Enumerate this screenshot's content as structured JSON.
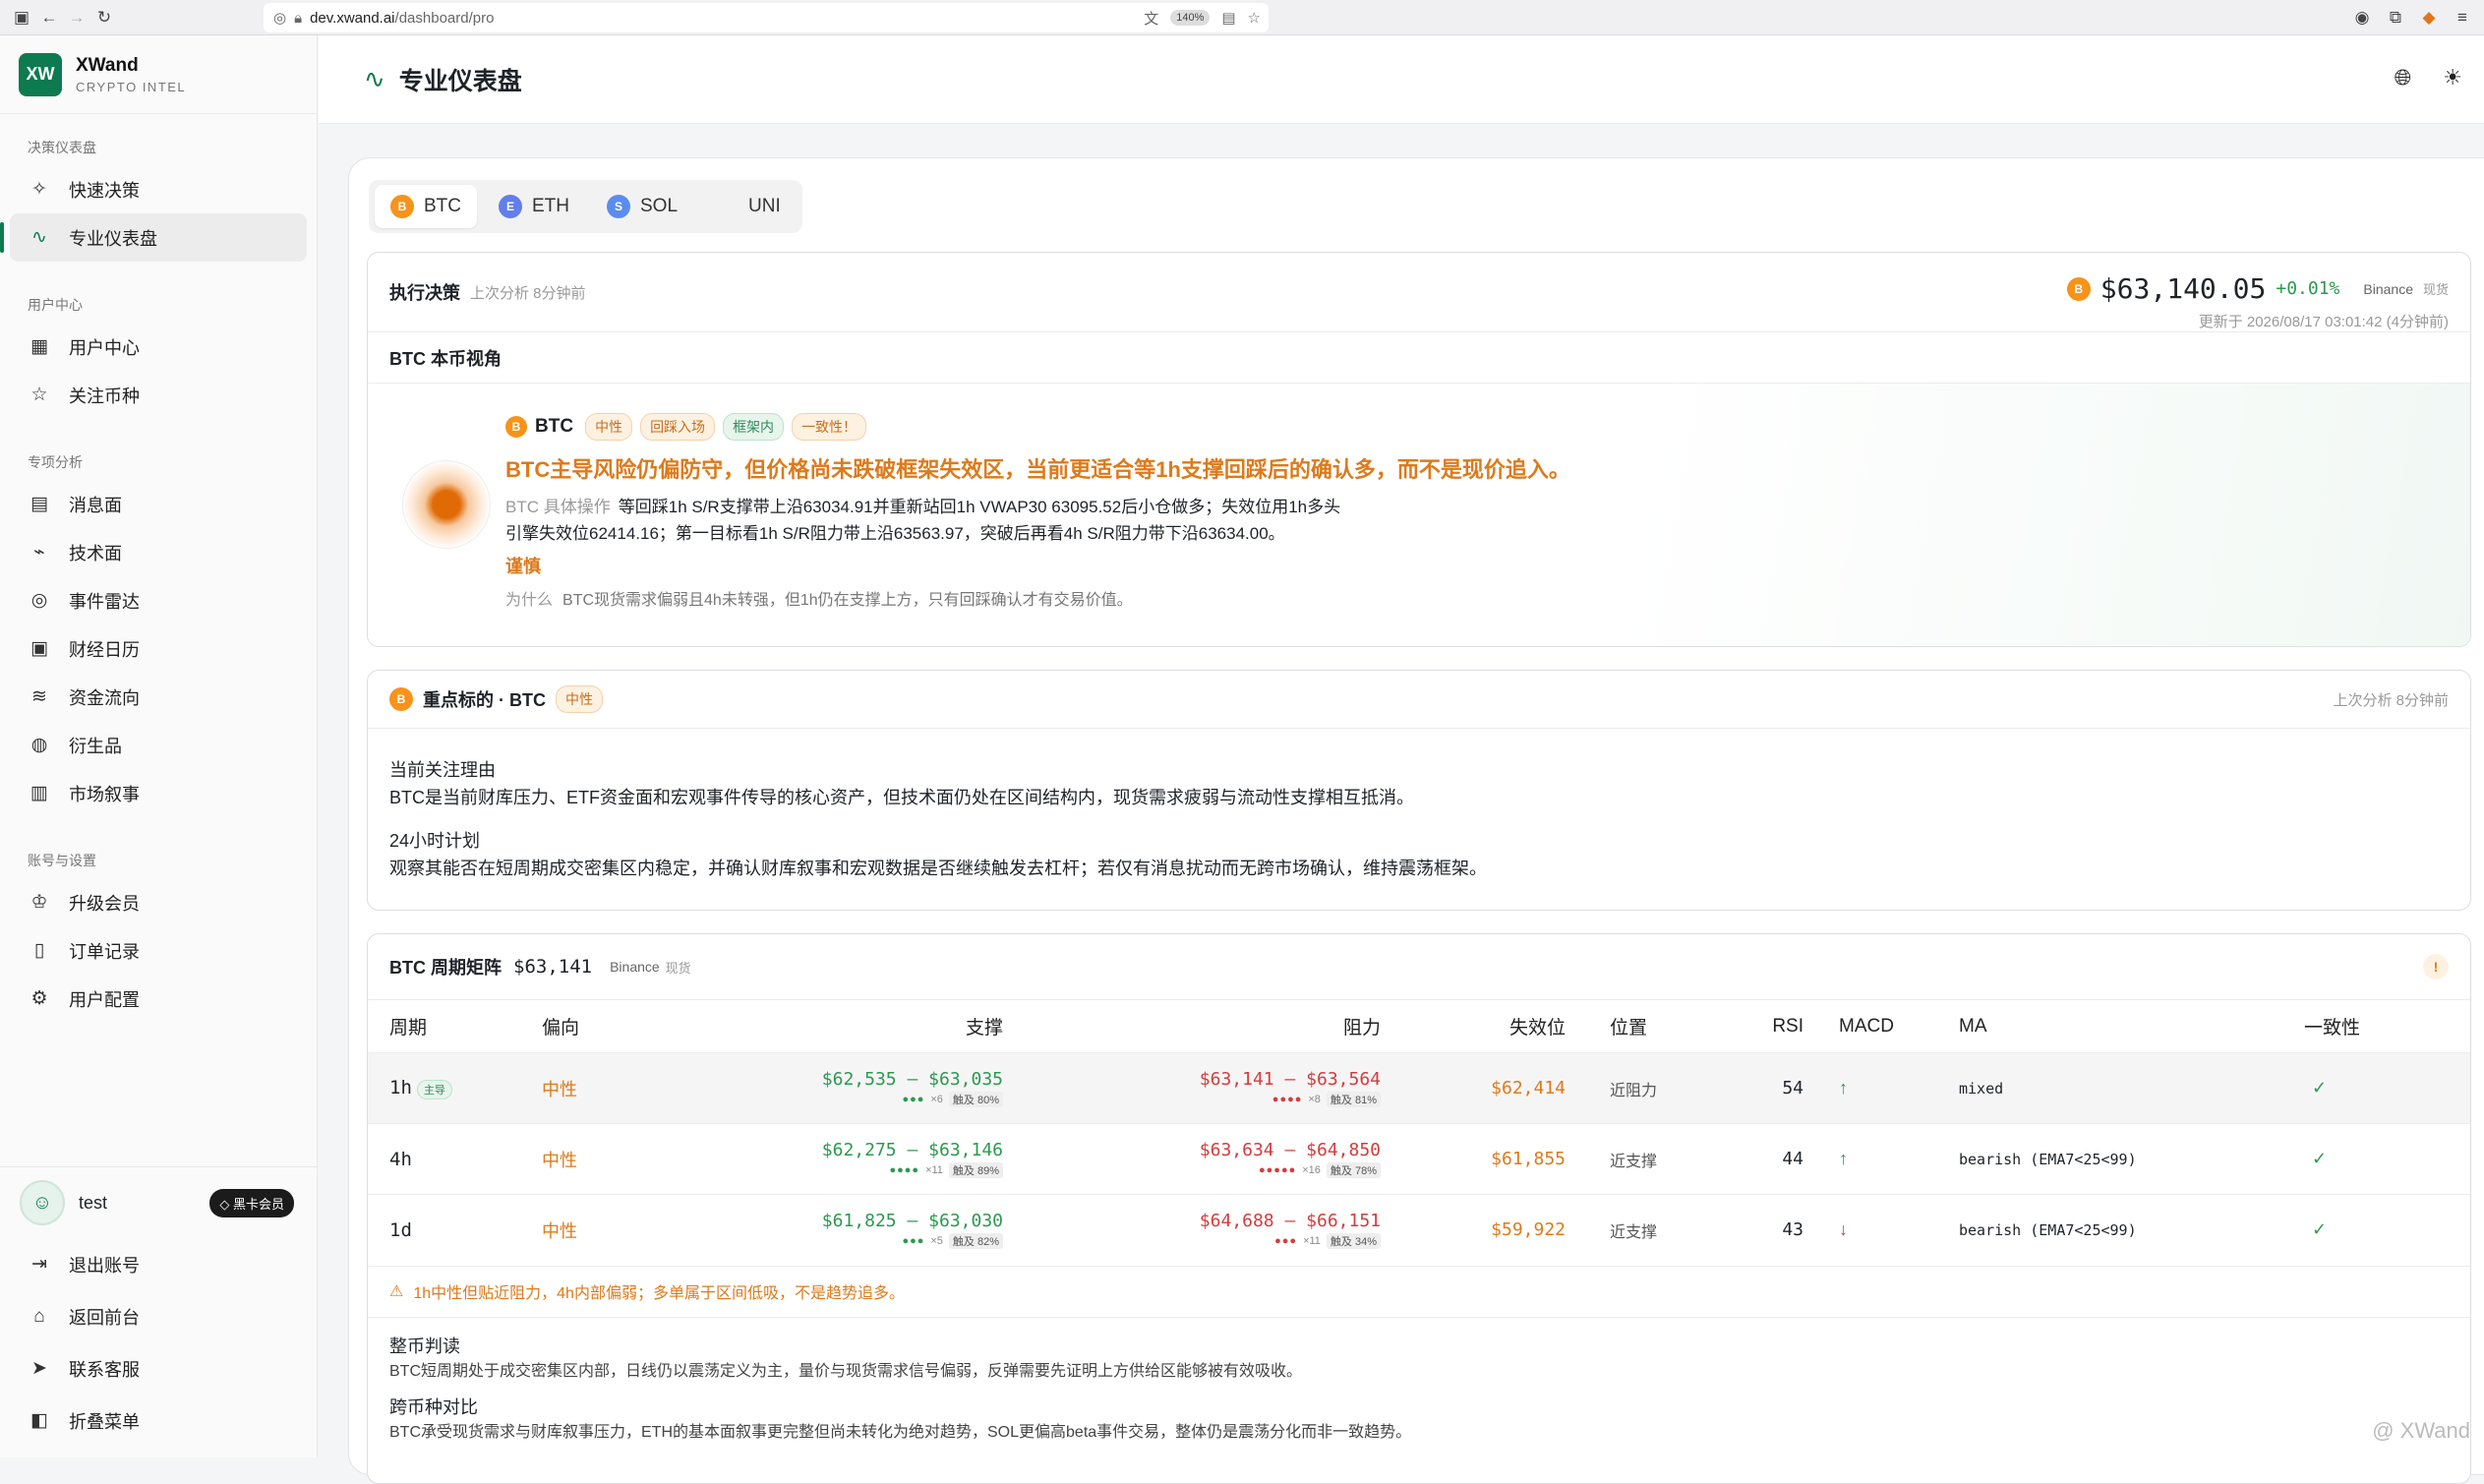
{
  "browser": {
    "url_host": "dev.xwand.ai",
    "url_path": "/dashboard/pro",
    "zoom": "140%"
  },
  "brand": {
    "logo_text": "XW",
    "name": "XWand",
    "subtitle": "CRYPTO INTEL"
  },
  "sidebar": {
    "sections": [
      {
        "title": "决策仪表盘",
        "items": [
          {
            "label": "快速决策",
            "icon": "sparkles-icon"
          },
          {
            "label": "专业仪表盘",
            "icon": "activity-icon",
            "active": true
          }
        ]
      },
      {
        "title": "用户中心",
        "items": [
          {
            "label": "用户中心",
            "icon": "grid-icon"
          },
          {
            "label": "关注币种",
            "icon": "star-icon"
          }
        ]
      },
      {
        "title": "专项分析",
        "items": [
          {
            "label": "消息面",
            "icon": "newspaper-icon"
          },
          {
            "label": "技术面",
            "icon": "pulse-icon"
          },
          {
            "label": "事件雷达",
            "icon": "radar-icon"
          },
          {
            "label": "财经日历",
            "icon": "calendar-icon"
          },
          {
            "label": "资金流向",
            "icon": "waves-icon"
          },
          {
            "label": "衍生品",
            "icon": "coins-icon"
          },
          {
            "label": "市场叙事",
            "icon": "book-icon"
          }
        ]
      },
      {
        "title": "账号与设置",
        "items": [
          {
            "label": "升级会员",
            "icon": "crown-icon"
          },
          {
            "label": "订单记录",
            "icon": "clipboard-icon"
          },
          {
            "label": "用户配置",
            "icon": "gear-icon"
          }
        ]
      }
    ],
    "user": {
      "name": "test",
      "badge": "黑卡会员"
    },
    "bottom_items": [
      {
        "label": "退出账号",
        "icon": "logout-icon"
      },
      {
        "label": "返回前台",
        "icon": "home-icon"
      },
      {
        "label": "联系客服",
        "icon": "telegram-icon"
      },
      {
        "label": "折叠菜单",
        "icon": "collapse-icon"
      }
    ]
  },
  "header": {
    "title": "专业仪表盘"
  },
  "tabs": [
    {
      "label": "BTC",
      "letter": "B",
      "color": "#f7931a",
      "active": true
    },
    {
      "label": "ETH",
      "letter": "E",
      "color": "#627eea"
    },
    {
      "label": "SOL",
      "letter": "S",
      "color": "#5b8def"
    },
    {
      "label": "UNI",
      "letter": "",
      "color": ""
    }
  ],
  "decision": {
    "title": "执行决策",
    "last_analysis": "上次分析 8分钟前",
    "price": "$63,140.05",
    "change": "+0.01%",
    "exchange": "Binance",
    "market": "现货",
    "updated": "更新于 2026/08/17 03:01:42 (4分钟前)",
    "view_title": "BTC 本币视角",
    "coin": "BTC",
    "tags": [
      "中性",
      "回踩入场",
      "框架内",
      "一致性！"
    ],
    "headline": "BTC主导风险仍偏防守，但价格尚未跌破框架失效区，当前更适合等1h支撑回踩后的确认多，而不是现价追入。",
    "op_label": "BTC 具体操作",
    "op_line1": "等回踩1h S/R支撑带上沿63034.91并重新站回1h VWAP30 63095.52后小仓做多；失效位用1h多头",
    "op_line2": "引擎失效位62414.16；第一目标看1h S/R阻力带上沿63563.97，突破后再看4h S/R阻力带下沿63634.00。",
    "caution": "谨慎",
    "why_label": "为什么",
    "why_text": "BTC现货需求偏弱且4h未转强，但1h仍在支撑上方，只有回踩确认才有交易价值。"
  },
  "focus": {
    "title": "重点标的 · BTC",
    "tag": "中性",
    "last_analysis": "上次分析 8分钟前",
    "reason_title": "当前关注理由",
    "reason_text": "BTC是当前财库压力、ETF资金面和宏观事件传导的核心资产，但技术面仍处在区间结构内，现货需求疲弱与流动性支撑相互抵消。",
    "plan_title": "24小时计划",
    "plan_text": "观察其能否在短周期成交密集区内稳定，并确认财库叙事和宏观数据是否继续触发去杠杆；若仅有消息扰动而无跨市场确认，维持震荡框架。"
  },
  "matrix": {
    "title": "BTC 周期矩阵",
    "price": "$63,141",
    "exchange": "Binance",
    "market": "现货",
    "columns": [
      "周期",
      "偏向",
      "支撑",
      "阻力",
      "失效位",
      "位置",
      "RSI",
      "MACD",
      "MA",
      "一致性"
    ],
    "rows": [
      {
        "period": "1h",
        "main": "主导",
        "bias": "中性",
        "sup_low": "$62,535",
        "sup_high": "$63,035",
        "sup_dots": "●●●",
        "sup_count": "×6",
        "sup_hit": "触及 80%",
        "res_low": "$63,141",
        "res_high": "$63,564",
        "res_dots": "●●●●",
        "res_count": "×8",
        "res_hit": "触及 81%",
        "stop": "$62,414",
        "position": "近阻力",
        "rsi": "54",
        "macd": "↑",
        "ma": "mixed",
        "consistent": "✓"
      },
      {
        "period": "4h",
        "main": "",
        "bias": "中性",
        "sup_low": "$62,275",
        "sup_high": "$63,146",
        "sup_dots": "●●●●",
        "sup_count": "×11",
        "sup_hit": "触及 89%",
        "res_low": "$63,634",
        "res_high": "$64,850",
        "res_dots": "●●●●●",
        "res_count": "×16",
        "res_hit": "触及 78%",
        "stop": "$61,855",
        "position": "近支撑",
        "rsi": "44",
        "macd": "↑",
        "ma": "bearish (EMA7<25<99)",
        "consistent": "✓"
      },
      {
        "period": "1d",
        "main": "",
        "bias": "中性",
        "sup_low": "$61,825",
        "sup_high": "$63,030",
        "sup_dots": "●●●",
        "sup_count": "×5",
        "sup_hit": "触及 82%",
        "res_low": "$64,688",
        "res_high": "$66,151",
        "res_dots": "●●●",
        "res_count": "×11",
        "res_hit": "触及 34%",
        "stop": "$59,922",
        "position": "近支撑",
        "rsi": "43",
        "macd": "↓",
        "ma": "bearish (EMA7<25<99)",
        "consistent": "✓"
      }
    ],
    "warning": "1h中性但贴近阻力，4h内部偏弱；多单属于区间低吸，不是趋势追多。",
    "overall_title": "整币判读",
    "overall_text": "BTC短周期处于成交密集区内部，日线仍以震荡定义为主，量价与现货需求信号偏弱，反弹需要先证明上方供给区能够被有效吸收。",
    "cross_title": "跨币种对比",
    "cross_text": "BTC承受现货需求与财库叙事压力，ETH的基本面叙事更完整但尚未转化为绝对趋势，SOL更偏高beta事件交易，整体仍是震荡分化而非一致趋势。"
  },
  "watermark": "@ XWand"
}
